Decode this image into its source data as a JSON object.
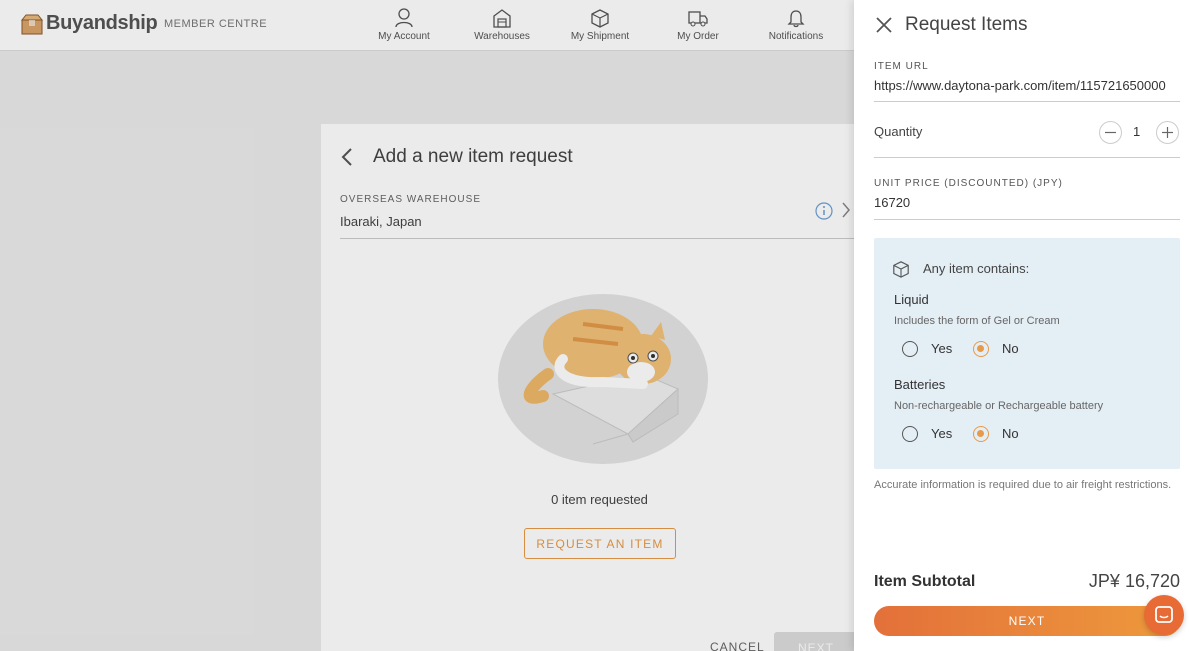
{
  "brand": {
    "name": "Buyandship",
    "subtitle": "MEMBER CENTRE"
  },
  "nav": [
    {
      "label": "My Account",
      "icon": "user-icon"
    },
    {
      "label": "Warehouses",
      "icon": "warehouse-icon"
    },
    {
      "label": "My Shipment",
      "icon": "box-icon"
    },
    {
      "label": "My Order",
      "icon": "truck-icon"
    },
    {
      "label": "Notifications",
      "icon": "bell-icon"
    }
  ],
  "card": {
    "title": "Add a new item request",
    "warehouse_label": "OVERSEAS WAREHOUSE",
    "warehouse_value": "Ibaraki, Japan",
    "empty_text": "0 item requested",
    "request_button": "REQUEST AN ITEM",
    "cancel": "CANCEL",
    "next": "NEXT"
  },
  "panel": {
    "title": "Request Items",
    "item_url_label": "ITEM URL",
    "item_url_value": "https://www.daytona-park.com/item/115721650000",
    "quantity_label": "Quantity",
    "quantity_value": "1",
    "unit_price_label": "UNIT PRICE (DISCOUNTED) (JPY)",
    "unit_price_value": "16720",
    "contains": {
      "heading": "Any item contains:",
      "liquid": {
        "title": "Liquid",
        "desc": "Includes the form of Gel or Cream",
        "yes": "Yes",
        "no": "No",
        "selected": "No"
      },
      "batteries": {
        "title": "Batteries",
        "desc": "Non-rechargeable or Rechargeable battery",
        "yes": "Yes",
        "no": "No",
        "selected": "No"
      }
    },
    "note": "Accurate information is required due to air freight restrictions.",
    "subtotal_label": "Item Subtotal",
    "subtotal_value": "JP¥ 16,720",
    "next": "NEXT"
  },
  "colors": {
    "accent": "#e89a48",
    "panel_bg": "#e4eef5",
    "next_gradient_start": "#e3703a",
    "chat": "#e86a35"
  }
}
